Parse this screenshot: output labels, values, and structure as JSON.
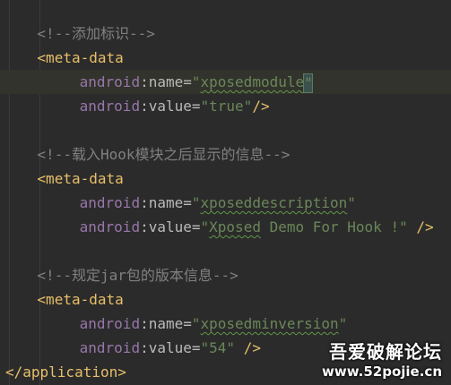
{
  "editor": {
    "lines": [
      {
        "indent": 3,
        "highlight": false,
        "segments": [
          {
            "cls": "comment",
            "text": "<!--添加标识-->"
          }
        ]
      },
      {
        "indent": 3,
        "highlight": false,
        "segments": [
          {
            "cls": "tag",
            "text": "<meta-data"
          }
        ]
      },
      {
        "indent": 7,
        "highlight": true,
        "segments": [
          {
            "cls": "attr-ns",
            "text": "android"
          },
          {
            "cls": "attr",
            "text": ":name="
          },
          {
            "cls": "quote",
            "text": "\""
          },
          {
            "cls": "str squig",
            "text": "xposedmodule"
          },
          {
            "cls": "cursor",
            "text": "\""
          }
        ]
      },
      {
        "indent": 7,
        "highlight": false,
        "segments": [
          {
            "cls": "attr-ns",
            "text": "android"
          },
          {
            "cls": "attr",
            "text": ":value="
          },
          {
            "cls": "str",
            "text": "\"true\""
          },
          {
            "cls": "tag",
            "text": "/>"
          }
        ]
      },
      {
        "indent": 0,
        "highlight": false,
        "segments": []
      },
      {
        "indent": 3,
        "highlight": false,
        "segments": [
          {
            "cls": "comment",
            "text": "<!--载入Hook模块之后显示的信息-->"
          }
        ]
      },
      {
        "indent": 3,
        "highlight": false,
        "segments": [
          {
            "cls": "tag",
            "text": "<meta-data"
          }
        ]
      },
      {
        "indent": 7,
        "highlight": false,
        "segments": [
          {
            "cls": "attr-ns",
            "text": "android"
          },
          {
            "cls": "attr",
            "text": ":name="
          },
          {
            "cls": "quote",
            "text": "\""
          },
          {
            "cls": "str squig",
            "text": "xposeddescription"
          },
          {
            "cls": "quote",
            "text": "\""
          }
        ]
      },
      {
        "indent": 7,
        "highlight": false,
        "segments": [
          {
            "cls": "attr-ns",
            "text": "android"
          },
          {
            "cls": "attr",
            "text": ":value="
          },
          {
            "cls": "quote",
            "text": "\""
          },
          {
            "cls": "str squig",
            "text": "Xposed"
          },
          {
            "cls": "str",
            "text": " Demo For Hook !\""
          },
          {
            "cls": "punct",
            "text": " "
          },
          {
            "cls": "tag",
            "text": "/>"
          }
        ]
      },
      {
        "indent": 0,
        "highlight": false,
        "segments": []
      },
      {
        "indent": 3,
        "highlight": false,
        "segments": [
          {
            "cls": "comment",
            "text": "<!--规定jar包的版本信息-->"
          }
        ]
      },
      {
        "indent": 3,
        "highlight": false,
        "segments": [
          {
            "cls": "tag",
            "text": "<meta-data"
          }
        ]
      },
      {
        "indent": 7,
        "highlight": false,
        "segments": [
          {
            "cls": "attr-ns",
            "text": "android"
          },
          {
            "cls": "attr",
            "text": ":name="
          },
          {
            "cls": "quote",
            "text": "\""
          },
          {
            "cls": "str squig",
            "text": "xposedminversion"
          },
          {
            "cls": "quote",
            "text": "\""
          }
        ]
      },
      {
        "indent": 7,
        "highlight": false,
        "segments": [
          {
            "cls": "attr-ns",
            "text": "android"
          },
          {
            "cls": "attr",
            "text": ":value="
          },
          {
            "cls": "str",
            "text": "\"54\""
          },
          {
            "cls": "punct",
            "text": " "
          },
          {
            "cls": "tag",
            "text": "/>"
          }
        ]
      },
      {
        "indent": 0,
        "highlight": false,
        "segments": [
          {
            "cls": "tag",
            "text": "</application>"
          }
        ]
      }
    ]
  },
  "watermark": {
    "title": "吾爱破解论坛",
    "url": "www.52pojie.cn"
  },
  "colors": {
    "background": "#2b2b2b",
    "comment": "#808080",
    "tag": "#e8bf6a",
    "attribute_namespace": "#9876aa",
    "string": "#6a8759"
  }
}
